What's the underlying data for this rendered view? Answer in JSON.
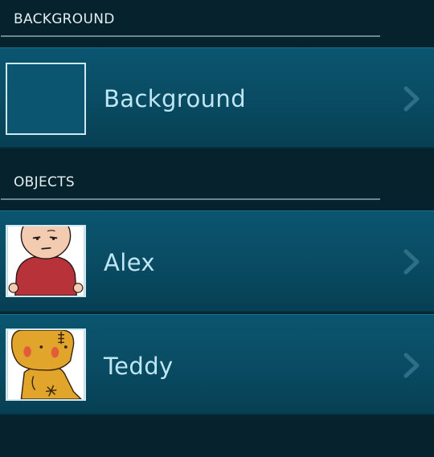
{
  "sections": [
    {
      "title": "BACKGROUND",
      "items": [
        {
          "label": "Background",
          "thumbnail": "empty-background-thumbnail"
        }
      ]
    },
    {
      "title": "OBJECTS",
      "items": [
        {
          "label": "Alex",
          "thumbnail": "alex-character-thumbnail"
        },
        {
          "label": "Teddy",
          "thumbnail": "teddy-character-thumbnail"
        }
      ]
    }
  ],
  "icons": {
    "chevron": "chevron-right-icon"
  },
  "colors": {
    "screen_bg": "#06222c",
    "row_bg": "#094b62",
    "label_text": "#bfe6f4",
    "header_text": "#e3eef2",
    "divider": "#6c8893"
  }
}
